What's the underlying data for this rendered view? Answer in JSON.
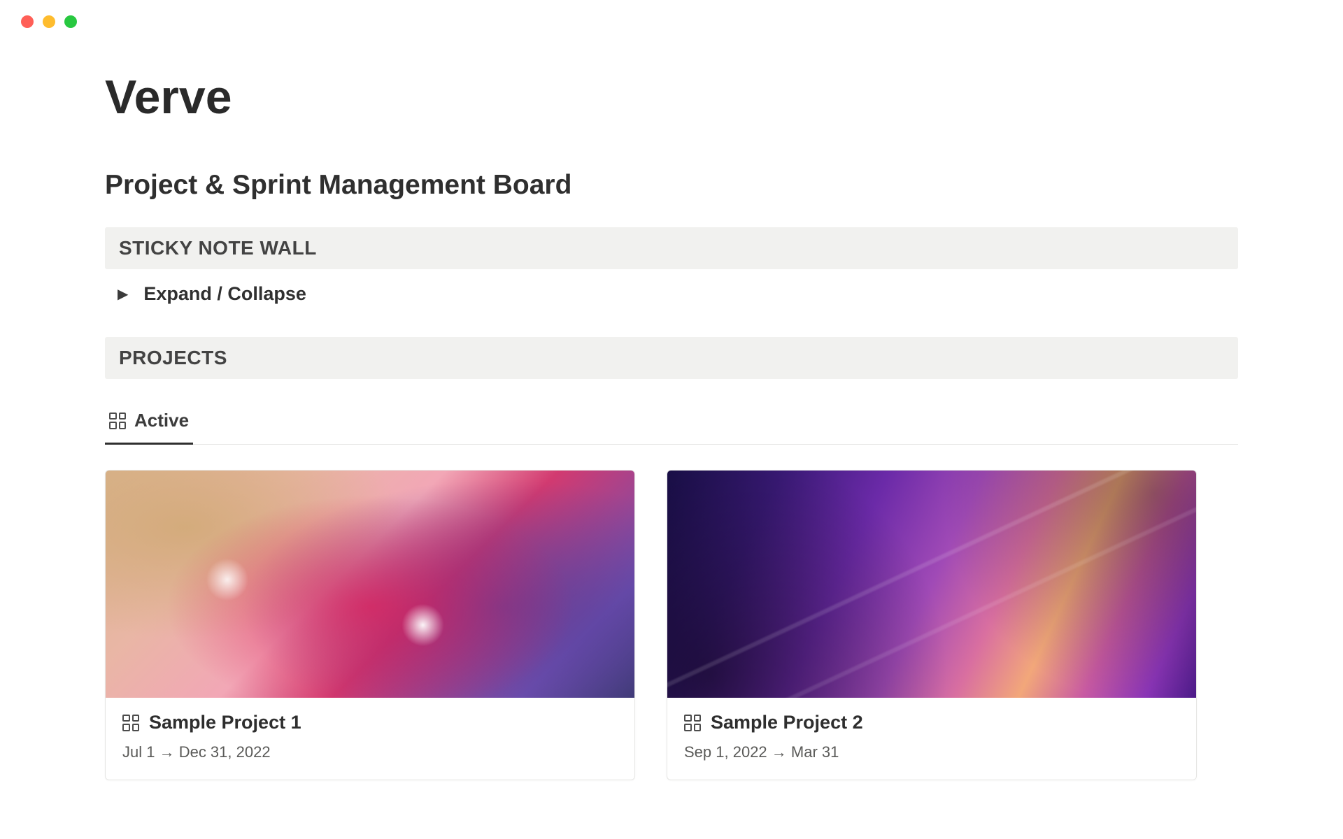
{
  "header": {
    "title": "Verve",
    "subtitle": "Project & Sprint Management Board"
  },
  "sticky": {
    "section_label": "STICKY NOTE WALL",
    "toggle_label": "Expand / Collapse"
  },
  "projects": {
    "section_label": "PROJECTS",
    "tab_active": "Active",
    "cards": [
      {
        "title": "Sample Project 1",
        "dates": "Jul 1 → Dec 31, 2022"
      },
      {
        "title": "Sample Project 2",
        "dates": "Sep 1, 2022 → Mar 31"
      }
    ]
  }
}
